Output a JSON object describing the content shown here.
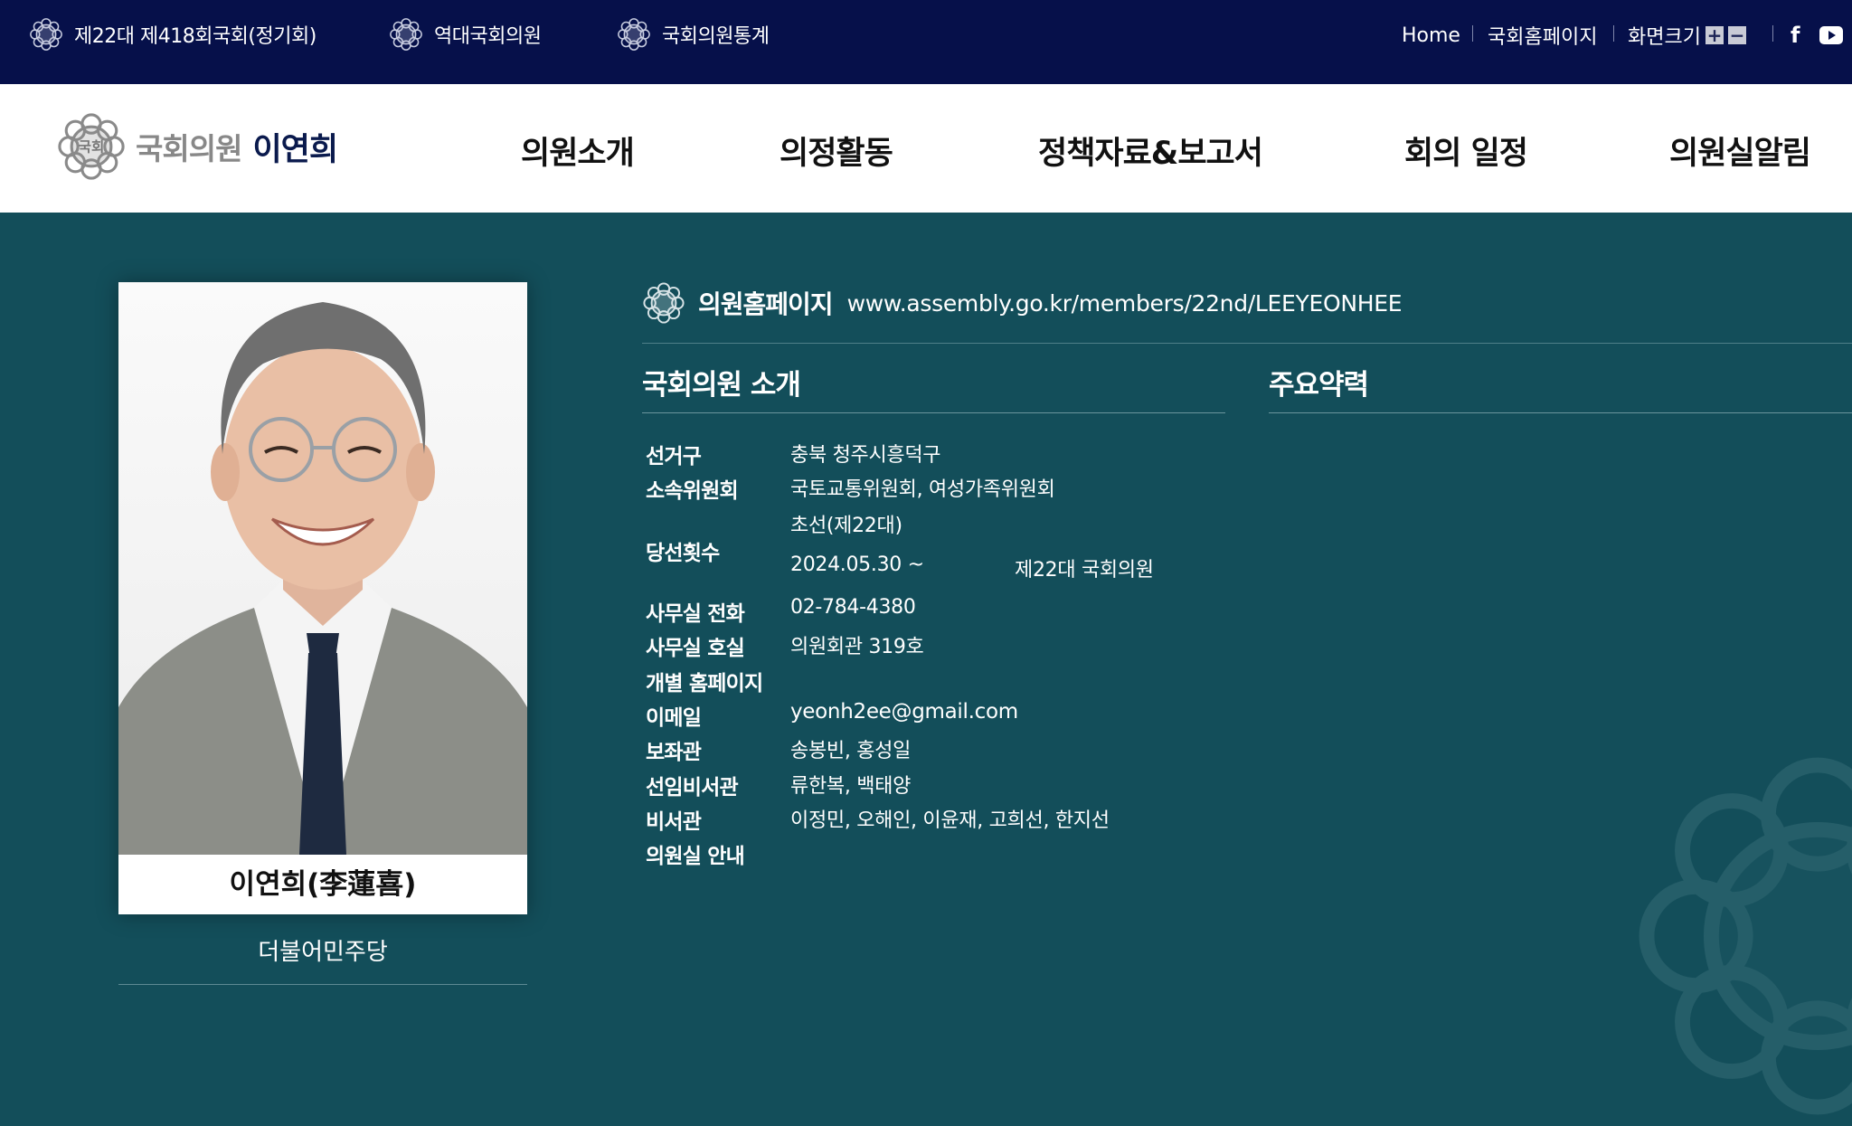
{
  "topbar": {
    "links": [
      {
        "label": "제22대 제418회국회(정기회)",
        "icon": "assembly-emblem-icon"
      },
      {
        "label": "역대국회의원",
        "icon": "assembly-emblem-icon"
      },
      {
        "label": "국회의원통계",
        "icon": "assembly-emblem-icon"
      }
    ],
    "home": "Home",
    "assembly_home": "국회홈페이지",
    "zoom_label": "화면크기",
    "zoom_in": "+",
    "zoom_out": "−",
    "social": [
      "facebook-icon",
      "youtube-icon"
    ]
  },
  "header": {
    "logo_sub": "국회의원",
    "logo_name": "이연희",
    "logo_mark": "국회",
    "nav": [
      "의원소개",
      "의정활동",
      "정책자료&보고서",
      "회의 일정",
      "의원실알림"
    ]
  },
  "profile": {
    "name": "이연희(李蓮喜)",
    "party": "더불어민주당"
  },
  "homepage": {
    "label": "의원홈페이지",
    "url": "www.assembly.go.kr/members/22nd/LEEYEONHEE"
  },
  "intro": {
    "title": "국회의원 소개",
    "rows": [
      {
        "label": "선거구",
        "value": "충북 청주시흥덕구"
      },
      {
        "label": "소속위원회",
        "value": "국토교통위원회, 여성가족위원회"
      },
      {
        "label": "당선횟수",
        "value": "초선(제22대)",
        "term_start": "2024.05.30 ~",
        "term_name": "제22대 국회의원"
      },
      {
        "label": "사무실 전화",
        "value": "02-784-4380"
      },
      {
        "label": "사무실 호실",
        "value": "의원회관 319호"
      },
      {
        "label": "개별 홈페이지",
        "value": ""
      },
      {
        "label": "이메일",
        "value": "yeonh2ee@gmail.com"
      },
      {
        "label": "보좌관",
        "value": "송봉빈, 홍성일"
      },
      {
        "label": "선임비서관",
        "value": "류한복, 백태양"
      },
      {
        "label": "비서관",
        "value": "이정민, 오해인, 이윤재, 고희선, 한지선"
      },
      {
        "label": "의원실 안내",
        "value": ""
      }
    ]
  },
  "career": {
    "title": "주요약력"
  },
  "colors": {
    "topbar": "#06104a",
    "main_bg": "#134e5a",
    "nav_text": "#111111"
  }
}
